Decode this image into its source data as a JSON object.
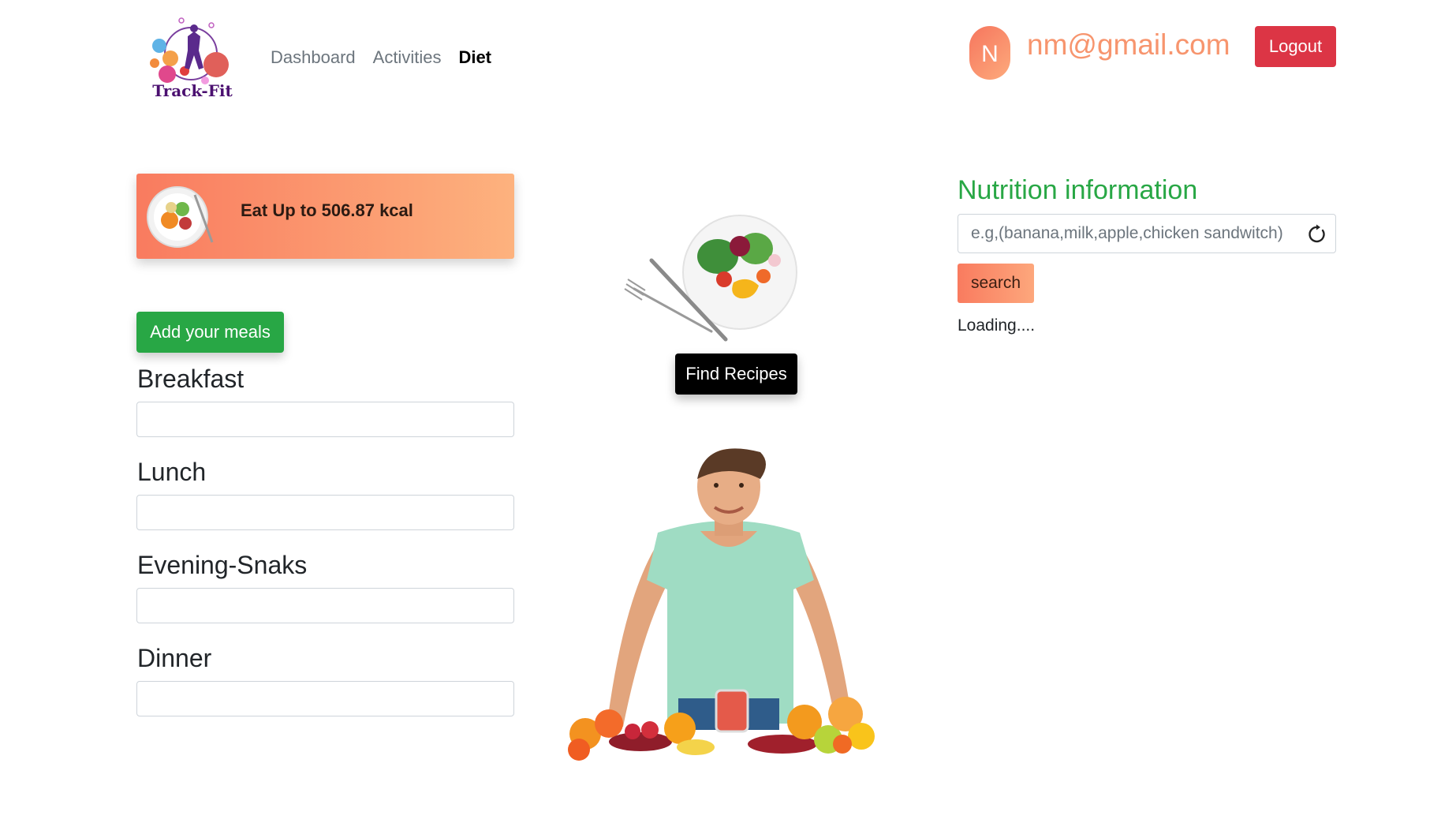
{
  "nav": {
    "brand": "Track-Fit",
    "links": [
      {
        "label": "Dashboard",
        "active": false
      },
      {
        "label": "Activities",
        "active": false
      },
      {
        "label": "Diet",
        "active": true
      }
    ]
  },
  "user": {
    "avatar_initial": "N",
    "email": "nm@gmail.com",
    "logout_label": "Logout"
  },
  "diet": {
    "calorie_text": "Eat Up to 506.87 kcal",
    "add_meals_label": "Add your meals",
    "meals": [
      {
        "label": "Breakfast",
        "value": ""
      },
      {
        "label": "Lunch",
        "value": ""
      },
      {
        "label": "Evening-Snaks",
        "value": ""
      },
      {
        "label": "Dinner",
        "value": ""
      }
    ],
    "find_recipes_label": "Find Recipes"
  },
  "nutrition": {
    "title": "Nutrition information",
    "placeholder": "e.g,(banana,milk,apple,chicken sandwitch)",
    "search_label": "search",
    "status": "Loading...."
  },
  "colors": {
    "accent_gradient_start": "#f97b5f",
    "accent_gradient_end": "#fdb27e",
    "success": "#28a745",
    "danger": "#dc3545"
  },
  "icons": [
    "refresh-icon"
  ]
}
